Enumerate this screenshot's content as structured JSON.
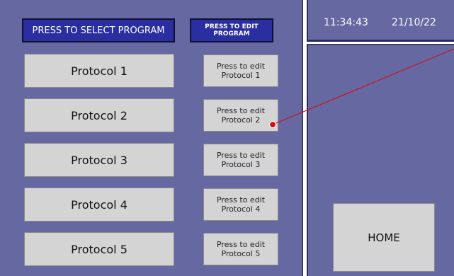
{
  "header": {
    "select_label": "PRESS TO SELECT PROGRAM",
    "edit_label": "PRESS TO EDIT\nPROGRAM"
  },
  "status": {
    "time": "11:34:43",
    "date": "21/10/22"
  },
  "protocols": [
    {
      "label": "Protocol 1",
      "edit_label": "Press to edit\nProtocol 1"
    },
    {
      "label": "Protocol 2",
      "edit_label": "Press to edit\nProtocol 2"
    },
    {
      "label": "Protocol 3",
      "edit_label": "Press to edit\nProtocol 3"
    },
    {
      "label": "Protocol 4",
      "edit_label": "Press to edit\nProtocol 4"
    },
    {
      "label": "Protocol 5",
      "edit_label": "Press to edit\nProtocol 5"
    }
  ],
  "home_label": "HOME",
  "colors": {
    "panel": "#6668a2",
    "header_button": "#2a2ea0",
    "button": "#d4d4d4",
    "annotation": "#d0101a"
  }
}
